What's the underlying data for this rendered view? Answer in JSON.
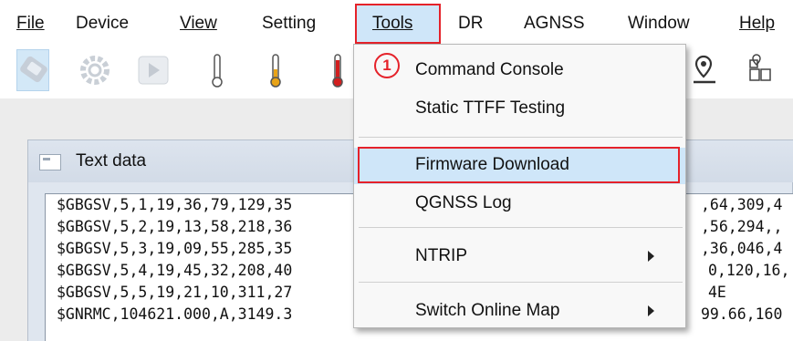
{
  "menubar": {
    "items": [
      {
        "label": "File",
        "accel_index": 0
      },
      {
        "label": "Device"
      },
      {
        "label": "View",
        "accel_index": 0
      },
      {
        "label": "Setting"
      },
      {
        "label": "Tools",
        "accel_index": 0
      },
      {
        "label": "DR"
      },
      {
        "label": "AGNSS"
      },
      {
        "label": "Window"
      },
      {
        "label": "Help",
        "accel_index": 0
      }
    ]
  },
  "toolbar": {
    "icons": [
      "connect-icon",
      "settings-gear-icon",
      "play-icon",
      "thermometer-cold-icon",
      "thermometer-warm-icon",
      "thermometer-hot-icon",
      "map-pin-icon",
      "map-grid-icon"
    ]
  },
  "panel": {
    "title": "Text data",
    "lines": [
      "$GBGSV,5,1,19,36,79,129,35",
      "$GBGSV,5,2,19,13,58,218,36",
      "$GBGSV,5,3,19,09,55,285,35",
      "$GBGSV,5,4,19,45,32,208,40",
      "$GBGSV,5,5,19,21,10,311,27",
      "$GNRMC,104621.000,A,3149.3"
    ],
    "right_fragments": [
      ",64,309,4",
      ",56,294,,",
      ",36,046,4",
      "0,120,16,",
      "4E",
      "99.66,160"
    ]
  },
  "dropdown": {
    "badge": "1",
    "items": [
      {
        "label": "Command Console"
      },
      {
        "label": "Static TTFF Testing"
      },
      {
        "label": "Firmware Download"
      },
      {
        "label": "QGNSS Log"
      },
      {
        "label": "NTRIP"
      },
      {
        "label": "Switch Online Map"
      }
    ]
  },
  "colors": {
    "highlight": "#cfe6f9",
    "annotation_red": "#e5222a"
  }
}
